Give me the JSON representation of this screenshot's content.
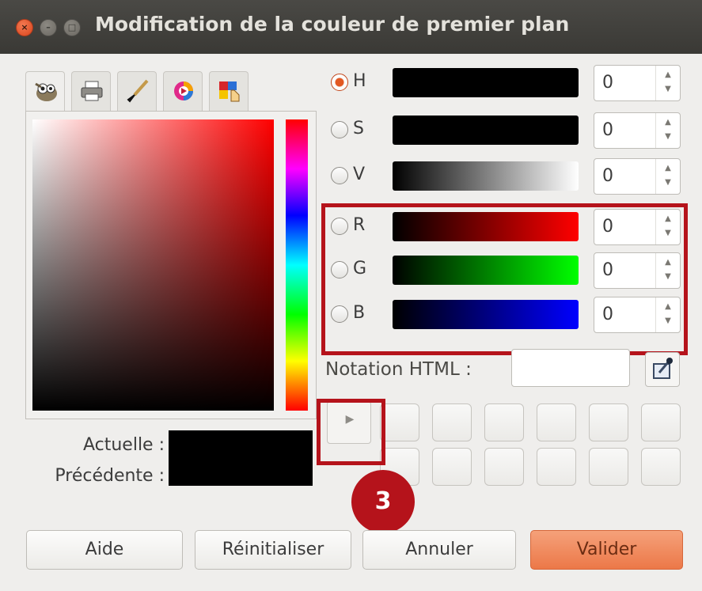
{
  "window": {
    "title": "Modification de la couleur de premier plan"
  },
  "tabs": [
    {
      "icon": "gimp-wilber-icon"
    },
    {
      "icon": "printer-icon"
    },
    {
      "icon": "paintbrush-icon"
    },
    {
      "icon": "color-wheel-icon"
    },
    {
      "icon": "palette-pointer-icon"
    }
  ],
  "swatches": {
    "current_label": "Actuelle :",
    "previous_label": "Précédente :",
    "current_color": "#000000",
    "previous_color": "#000000"
  },
  "channels": [
    {
      "label": "H",
      "value": "0",
      "selected": true
    },
    {
      "label": "S",
      "value": "0",
      "selected": false
    },
    {
      "label": "V",
      "value": "0",
      "selected": false
    },
    {
      "label": "R",
      "value": "0",
      "selected": false
    },
    {
      "label": "G",
      "value": "0",
      "selected": false
    },
    {
      "label": "B",
      "value": "0",
      "selected": false
    }
  ],
  "html_notation": {
    "label": "Notation HTML :",
    "value": ""
  },
  "annotation": {
    "step": "3",
    "color": "#b5131b"
  },
  "buttons": {
    "help": "Aide",
    "reset": "Réinitialiser",
    "cancel": "Annuler",
    "ok": "Valider"
  },
  "accent": "#ec7848"
}
